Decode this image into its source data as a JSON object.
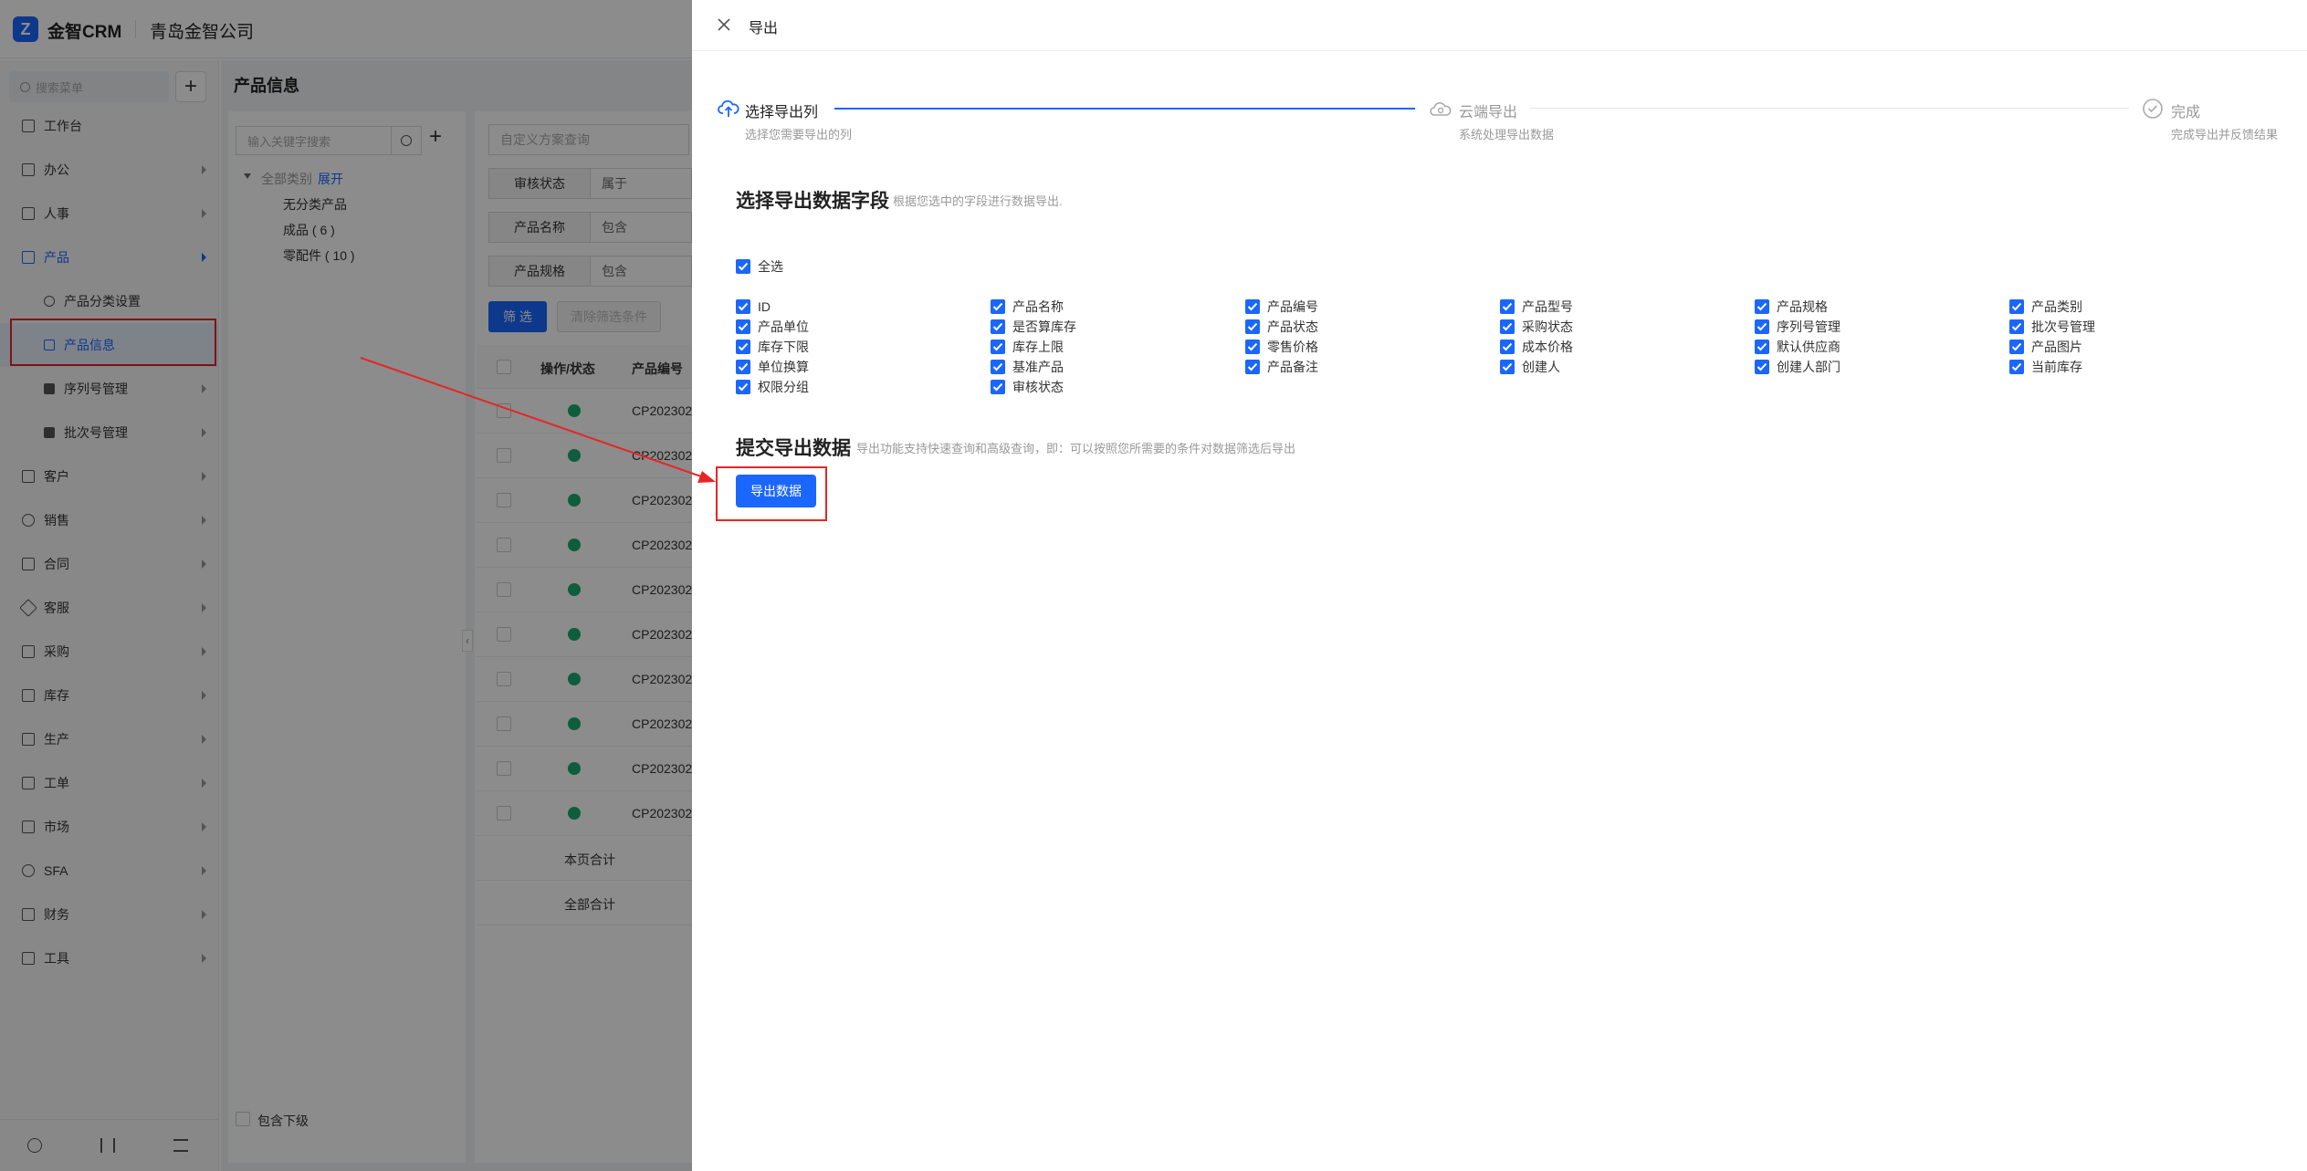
{
  "app": {
    "brand": "金智CRM",
    "company": "青岛金智公司",
    "search_placeholder": "搜索菜单",
    "add_symbol": "+",
    "page_title": "产品信息"
  },
  "sidebar": {
    "items": [
      {
        "label": "工作台"
      },
      {
        "label": "办公"
      },
      {
        "label": "人事"
      },
      {
        "label": "产品"
      },
      {
        "label": "产品分类设置"
      },
      {
        "label": "产品信息"
      },
      {
        "label": "序列号管理"
      },
      {
        "label": "批次号管理"
      },
      {
        "label": "客户"
      },
      {
        "label": "销售"
      },
      {
        "label": "合同"
      },
      {
        "label": "客服"
      },
      {
        "label": "采购"
      },
      {
        "label": "库存"
      },
      {
        "label": "生产"
      },
      {
        "label": "工单"
      },
      {
        "label": "市场"
      },
      {
        "label": "SFA"
      },
      {
        "label": "财务"
      },
      {
        "label": "工具"
      }
    ]
  },
  "category_panel": {
    "search_placeholder": "输入关键字搜索",
    "root": "全部类别",
    "expand": "展开",
    "nodes": [
      "无分类产品",
      "成品 ( 6 )",
      "零配件 ( 10 )"
    ],
    "include_sub": "包含下级"
  },
  "filter": {
    "scheme_placeholder": "自定义方案查询",
    "rows": [
      {
        "label": "审核状态",
        "op": "属于"
      },
      {
        "label": "产品名称",
        "op": "包含"
      },
      {
        "label": "产品规格",
        "op": "包含"
      }
    ],
    "filter_btn": "筛 选",
    "clear_btn": "清除筛选条件"
  },
  "table": {
    "headers": [
      "操作/状态",
      "产品编号"
    ],
    "rows": [
      "CP202302",
      "CP202302",
      "CP202302",
      "CP202302",
      "CP202302",
      "CP202302",
      "CP202302",
      "CP202302",
      "CP202302",
      "CP202302"
    ],
    "page_total": "本页合计",
    "all_total": "全部合计"
  },
  "drawer": {
    "title": "导出",
    "steps": [
      {
        "title": "选择导出列",
        "desc": "选择您需要导出的列"
      },
      {
        "title": "云端导出",
        "desc": "系统处理导出数据"
      },
      {
        "title": "完成",
        "desc": "完成导出并反馈结果"
      }
    ],
    "section1_title": "选择导出数据字段",
    "section1_hint": "根据您选中的字段进行数据导出.",
    "select_all": "全选",
    "fields": [
      "ID",
      "产品名称",
      "产品编号",
      "产品型号",
      "产品规格",
      "产品类别",
      "产品单位",
      "是否算库存",
      "产品状态",
      "采购状态",
      "序列号管理",
      "批次号管理",
      "库存下限",
      "库存上限",
      "零售价格",
      "成本价格",
      "默认供应商",
      "产品图片",
      "单位换算",
      "基准产品",
      "产品备注",
      "创建人",
      "创建人部门",
      "当前库存",
      "权限分组",
      "审核状态"
    ],
    "section2_title": "提交导出数据",
    "section2_hint": "导出功能支持快速查询和高级查询，即：可以按照您所需要的条件对数据筛选后导出",
    "export_btn": "导出数据"
  },
  "colors": {
    "primary": "#1a66ff",
    "annotation": "#e52626",
    "success": "#19a974"
  }
}
